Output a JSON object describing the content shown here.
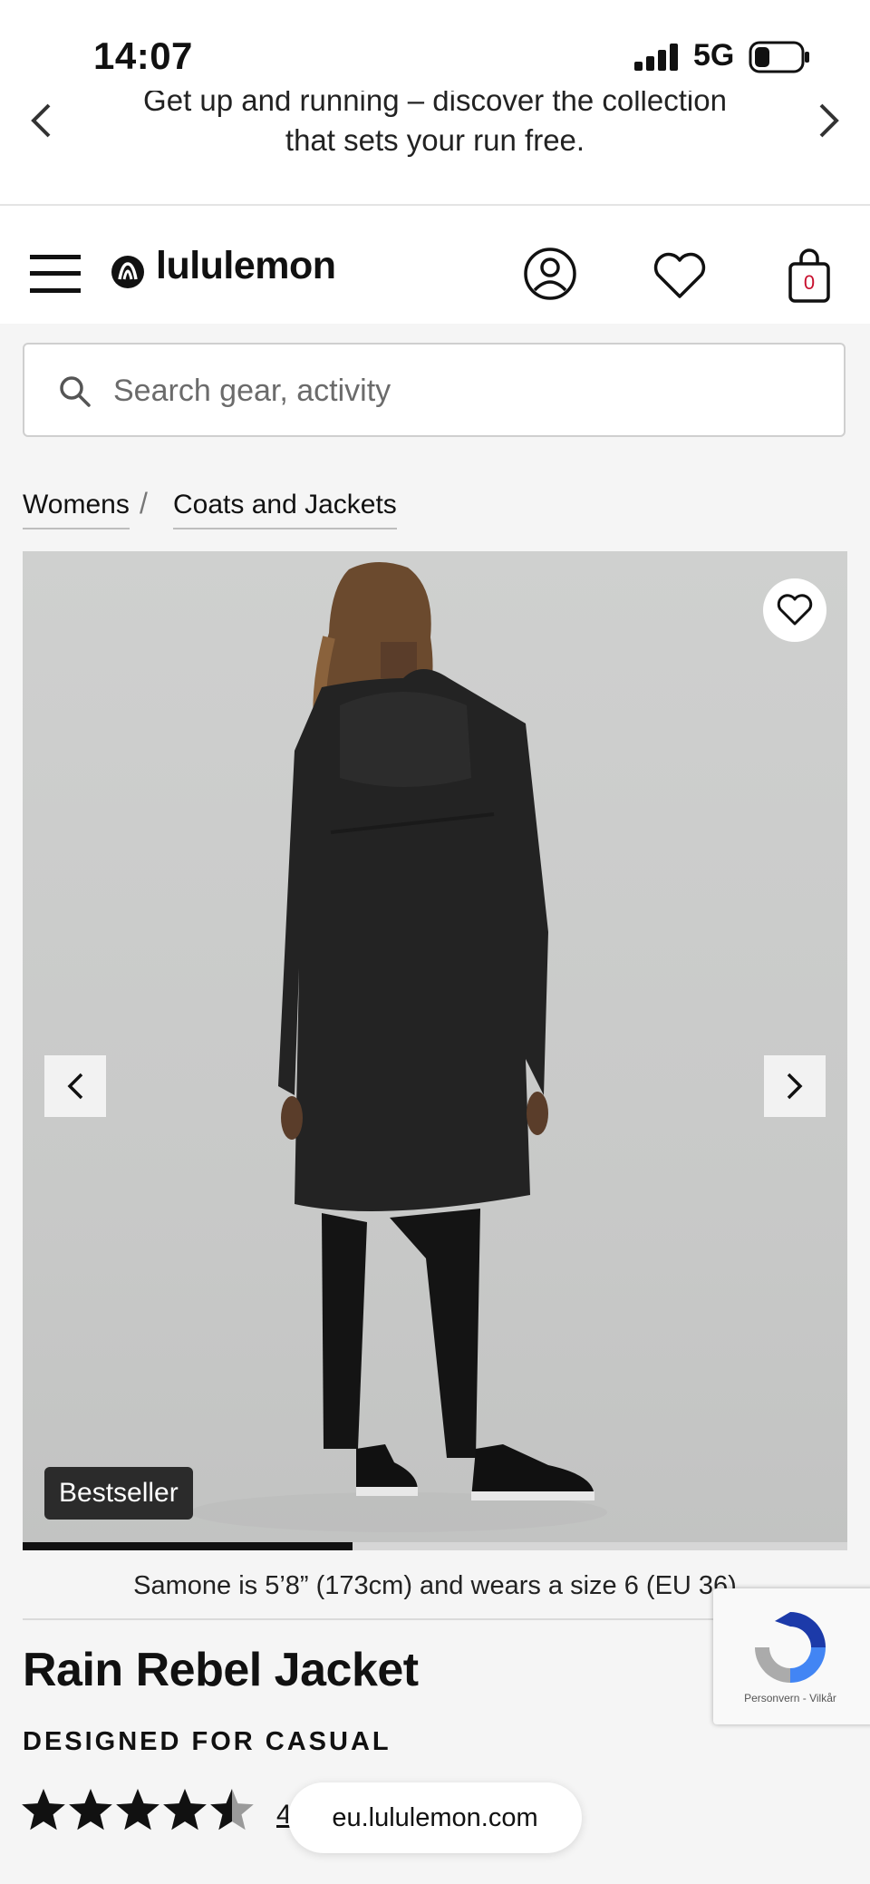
{
  "status_bar": {
    "time": "14:07",
    "network": "5G",
    "battery_level": 0.3
  },
  "promo": {
    "line1": "Get up and running – discover the collection",
    "line2": "that sets your run free."
  },
  "header": {
    "brand": "lululemon",
    "cart_count": "0"
  },
  "search": {
    "placeholder": "Search gear, activity"
  },
  "breadcrumb": {
    "items": [
      "Womens",
      "Coats and Jackets"
    ],
    "separator": "/"
  },
  "gallery": {
    "badge": "Bestseller",
    "progress": 0.4,
    "image_alt": "Woman wearing a long black rain jacket, back view"
  },
  "product": {
    "model_note": "Samone is 5’8” (173cm) and wears a size 6 (EU 36)",
    "name": "Rain Rebel Jacket",
    "tagline": "DESIGNED FOR CASUAL",
    "rating": 4.5,
    "review_count": "4"
  },
  "recaptcha": {
    "links": "Personvern - Vilkår"
  },
  "browser": {
    "url": "eu.lululemon.com"
  },
  "colors": {
    "accent": "#111111",
    "cart_count": "#c8102e",
    "background": "#f5f5f5"
  }
}
